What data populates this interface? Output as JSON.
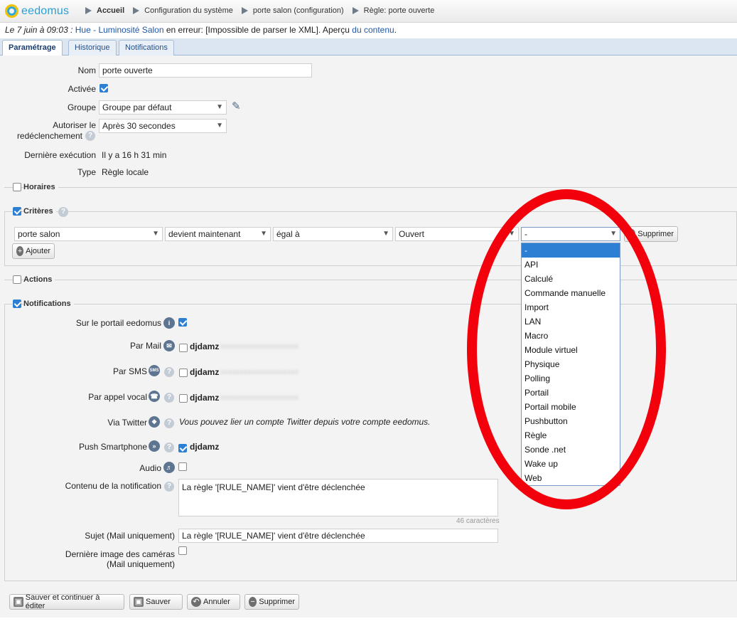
{
  "app": {
    "logo_text": "eedomus"
  },
  "breadcrumb": [
    {
      "label": "Accueil"
    },
    {
      "label": "Configuration du système"
    },
    {
      "label": "porte salon (configuration)"
    },
    {
      "label": "Règle: porte ouverte"
    }
  ],
  "error": {
    "date": "Le 7 juin à 09:03 :",
    "device": "Hue - Luminosité Salon",
    "message": " en erreur: [Impossible de parser le XML]. Aperçu ",
    "link": "du contenu",
    "end": "."
  },
  "tabs": [
    {
      "label": "Paramétrage"
    },
    {
      "label": "Historique"
    },
    {
      "label": "Notifications"
    }
  ],
  "form": {
    "nom_label": "Nom",
    "nom_value": "porte ouverte",
    "activee_label": "Activée",
    "groupe_label": "Groupe",
    "groupe_value": "Groupe par défaut",
    "autoriser_label_1": "Autoriser le",
    "autoriser_label_2": "redéclenchement",
    "autoriser_value": "Après 30 secondes",
    "derniere_label": "Dernière exécution",
    "derniere_value": "Il y a 16 h 31 min",
    "type_label": "Type",
    "type_value": "Règle locale"
  },
  "sections": {
    "horaires": "Horaires",
    "criteres": "Critères",
    "actions": "Actions",
    "notifications": "Notifications"
  },
  "criteria": {
    "device": "porte salon",
    "condition": "devient maintenant",
    "operator": "égal à",
    "value": "Ouvert",
    "source": "-",
    "delete_label": "Supprimer",
    "add_label": "Ajouter"
  },
  "dropdown": {
    "options": [
      "-",
      "API",
      "Calculé",
      "Commande manuelle",
      "Import",
      "LAN",
      "Macro",
      "Module virtuel",
      "Physique",
      "Polling",
      "Portail",
      "Portail mobile",
      "Pushbutton",
      "Règle",
      "Sonde .net",
      "Wake up",
      "Web"
    ]
  },
  "notifications": {
    "portail_label": "Sur le portail eedomus",
    "mail_label": "Par Mail",
    "mail_user": "djdamz",
    "sms_label": "Par SMS",
    "sms_user": "djdamz",
    "sms_badge": "SMS",
    "vocal_label": "Par appel vocal",
    "vocal_user": "djdamz",
    "twitter_label": "Via Twitter",
    "twitter_text": "Vous pouvez lier un compte Twitter depuis votre compte eedomus.",
    "push_label": "Push Smartphone",
    "push_user": "djdamz",
    "audio_label": "Audio",
    "contenu_label": "Contenu de la notification",
    "contenu_value": "La règle '[RULE_NAME]' vient d'être déclenchée",
    "counter": "46 caractères",
    "sujet_label": "Sujet (Mail uniquement)",
    "sujet_value": "La règle '[RULE_NAME]' vient d'être déclenchée",
    "image_label_1": "Dernière image des caméras",
    "image_label_2": "(Mail uniquement)"
  },
  "buttons": {
    "save_continue": "Sauver et continuer à éditer",
    "save": "Sauver",
    "cancel": "Annuler",
    "delete": "Supprimer"
  },
  "colors": {
    "accent": "#2d7fd3",
    "annotation": "#f2000c"
  }
}
